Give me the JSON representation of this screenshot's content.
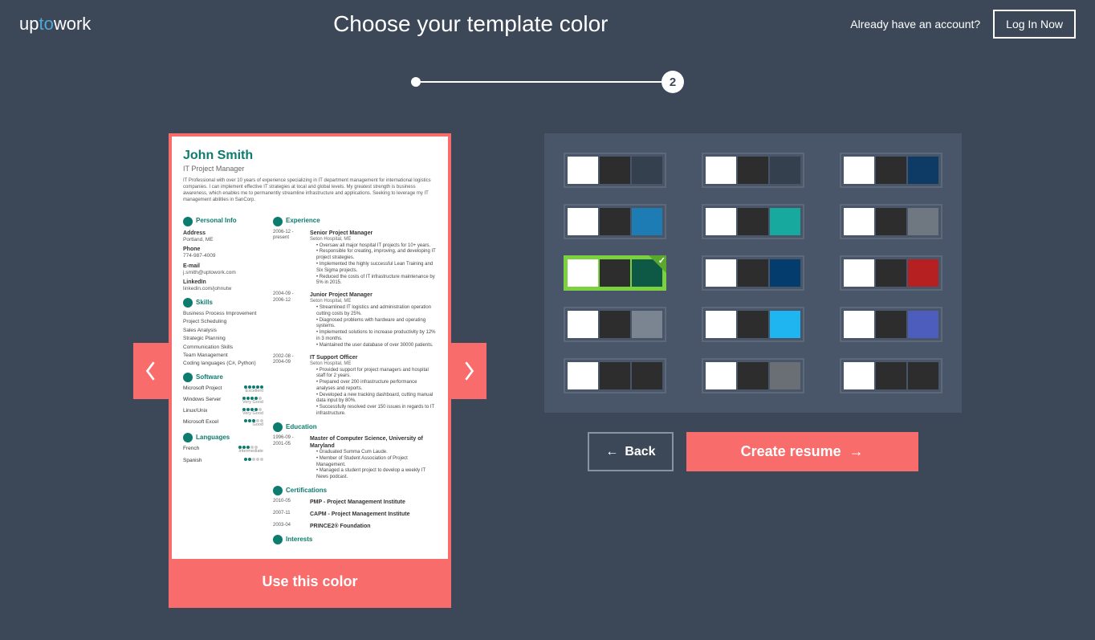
{
  "logo": {
    "part1": "up",
    "part2": "to",
    "part3": "work"
  },
  "page_title": "Choose your template color",
  "account_prompt": "Already have an account?",
  "login_label": "Log In Now",
  "step_number": "2",
  "buttons": {
    "use_color": "Use this color",
    "back": "Back",
    "create": "Create resume"
  },
  "resume": {
    "name": "John Smith",
    "role": "IT Project Manager",
    "summary": "IT Professional with over 10 years of experience specializing in IT department management for international logistics companies. I can implement effective IT strategies at local and global levels. My greatest strength is business awareness, which enables me to permanently streamline infrastructure and applications. Seeking to leverage my IT management abilities in SanCorp.",
    "sections": {
      "personal": "Personal Info",
      "skills": "Skills",
      "software": "Software",
      "languages": "Languages",
      "experience": "Experience",
      "education": "Education",
      "certifications": "Certifications",
      "interests": "Interests"
    },
    "personal": [
      {
        "label": "Address",
        "value": "Portland, ME"
      },
      {
        "label": "Phone",
        "value": "774-987-4009"
      },
      {
        "label": "E-mail",
        "value": "j.smith@uptowork.com"
      },
      {
        "label": "LinkedIn",
        "value": "linkedin.com/johnutw"
      }
    ],
    "skills": [
      "Business Process Improvement",
      "Project Scheduling",
      "Sales Analysis",
      "Strategic Planning",
      "Communication Skills",
      "Team Management",
      "Coding languages (C#, Python)"
    ],
    "software": [
      {
        "name": "Microsoft Project",
        "rating": 5,
        "level": "Excellent"
      },
      {
        "name": "Windows Server",
        "rating": 4,
        "level": "Very Good"
      },
      {
        "name": "Linux/Unix",
        "rating": 4,
        "level": "Very Good"
      },
      {
        "name": "Microsoft Excel",
        "rating": 3,
        "level": "Good"
      }
    ],
    "languages": [
      {
        "name": "French",
        "rating": 3,
        "level": "Intermediate"
      },
      {
        "name": "Spanish",
        "rating": 2,
        "level": ""
      }
    ],
    "experience": [
      {
        "dates": "2006-12 - present",
        "title": "Senior Project Manager",
        "company": "Seton Hospital, ME",
        "bullets": [
          "Oversaw all major hospital IT projects for 10+ years.",
          "Responsible for creating, improving, and developing IT project strategies.",
          "Implemented the highly successful Lean Training and Six Sigma projects.",
          "Reduced the costs of IT infrastructure maintenance by 5% in 2015."
        ]
      },
      {
        "dates": "2004-09 - 2006-12",
        "title": "Junior Project Manager",
        "company": "Seton Hospital, ME",
        "bullets": [
          "Streamlined IT logistics and administration operation cutting costs by 25%.",
          "Diagnosed problems with hardware and operating systems.",
          "Implemented solutions to increase productivity by 12% in 3 months.",
          "Maintained the user database of over 30000 patients."
        ]
      },
      {
        "dates": "2002-08 - 2004-09",
        "title": "IT Support Officer",
        "company": "Seton Hospital, ME",
        "bullets": [
          "Provided support for project managers and hospital staff for 2 years.",
          "Prepared over 200 infrastructure performance analyses and reports.",
          "Developed a new tracking dashboard, cutting manual data input by 80%.",
          "Successfully resolved over 150 issues in regards to IT infrastructure."
        ]
      }
    ],
    "education": [
      {
        "dates": "1996-09 - 2001-05",
        "title": "Master of Computer Science, University of Maryland",
        "bullets": [
          "Graduated Summa Cum Laude.",
          "Member of Student Association of Project Management.",
          "Managed a student project to develop a weekly IT News podcast."
        ]
      }
    ],
    "certifications": [
      {
        "dates": "2010-05",
        "title": "PMP - Project Management Institute"
      },
      {
        "dates": "2007-11",
        "title": "CAPM - Project Management Institute"
      },
      {
        "dates": "2003-04",
        "title": "PRINCE2® Foundation"
      }
    ]
  },
  "colors": [
    [
      [
        "#ffffff",
        "#2d2d2d",
        "#35404f"
      ],
      [
        "#ffffff",
        "#2d2d2d",
        "#35404f"
      ],
      [
        "#ffffff",
        "#2d2d2d",
        "#0d3b66"
      ]
    ],
    [
      [
        "#ffffff",
        "#2d2d2d",
        "#1c7cb3"
      ],
      [
        "#ffffff",
        "#2d2d2d",
        "#17a89e"
      ],
      [
        "#ffffff",
        "#2d2d2d",
        "#6f7780"
      ]
    ],
    [
      [
        "#ffffff",
        "#2d2d2d",
        "#0d5945"
      ],
      [
        "#ffffff",
        "#2d2d2d",
        "#043c6e"
      ],
      [
        "#ffffff",
        "#2d2d2d",
        "#b62020"
      ]
    ],
    [
      [
        "#ffffff",
        "#2d2d2d",
        "#7a8591"
      ],
      [
        "#ffffff",
        "#2d2d2d",
        "#1fb5f0"
      ],
      [
        "#ffffff",
        "#2d2d2d",
        "#4d5dbd"
      ]
    ],
    [
      [
        "#ffffff",
        "#2d2d2d",
        "#2d2d2d"
      ],
      [
        "#ffffff",
        "#2d2d2d",
        "#6a6f76"
      ],
      [
        "#ffffff",
        "#2d2d2d",
        "#2d2d2d"
      ]
    ]
  ],
  "selected_row": 2,
  "selected_col": 0
}
